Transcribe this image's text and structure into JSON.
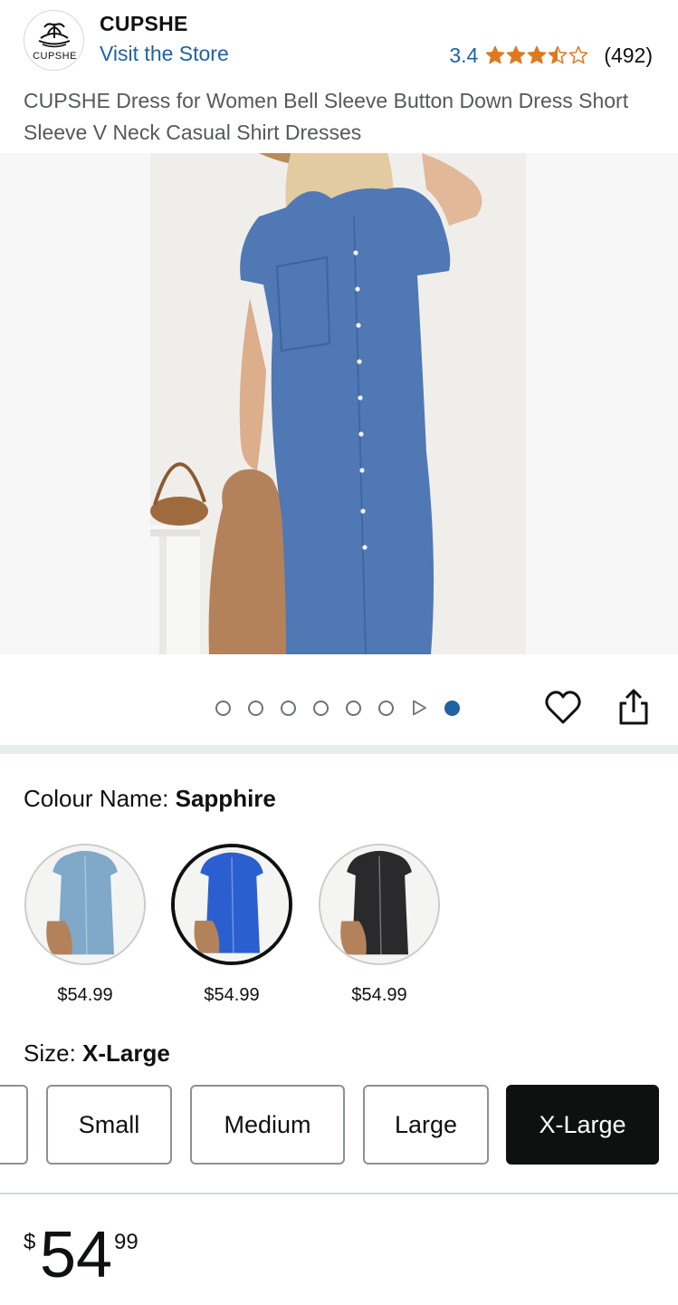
{
  "header": {
    "brand_name": "CUPSHE",
    "logo_text": "CUPSHE",
    "visit_store": "Visit the Store",
    "rating_value": "3.4",
    "rating_stars": 3.5,
    "rating_count": "(492)"
  },
  "product": {
    "title": "CUPSHE Dress for Women Bell Sleeve Button Down Dress Short Sleeve V Neck Casual Shirt Dresses"
  },
  "carousel": {
    "image_count": 8,
    "active_index": 7,
    "video_index": 6
  },
  "colour": {
    "label": "Colour Name: ",
    "selected": "Sapphire",
    "swatches": [
      {
        "name": "light-blue",
        "price": "$54.99",
        "color": "#7fa8c9"
      },
      {
        "name": "sapphire",
        "price": "$54.99",
        "color": "#2b5fd0"
      },
      {
        "name": "black",
        "price": "$54.99",
        "color": "#2a2a2c"
      }
    ]
  },
  "size": {
    "label": "Size: ",
    "selected": "X-Large",
    "options": [
      "Small",
      "Medium",
      "Large",
      "X-Large"
    ]
  },
  "price": {
    "symbol": "$",
    "whole": "54",
    "fraction": "99"
  },
  "colors": {
    "link_blue": "#2162a1",
    "star_orange": "#de7921",
    "text_dark": "#0f1111",
    "text_muted": "#565959"
  }
}
